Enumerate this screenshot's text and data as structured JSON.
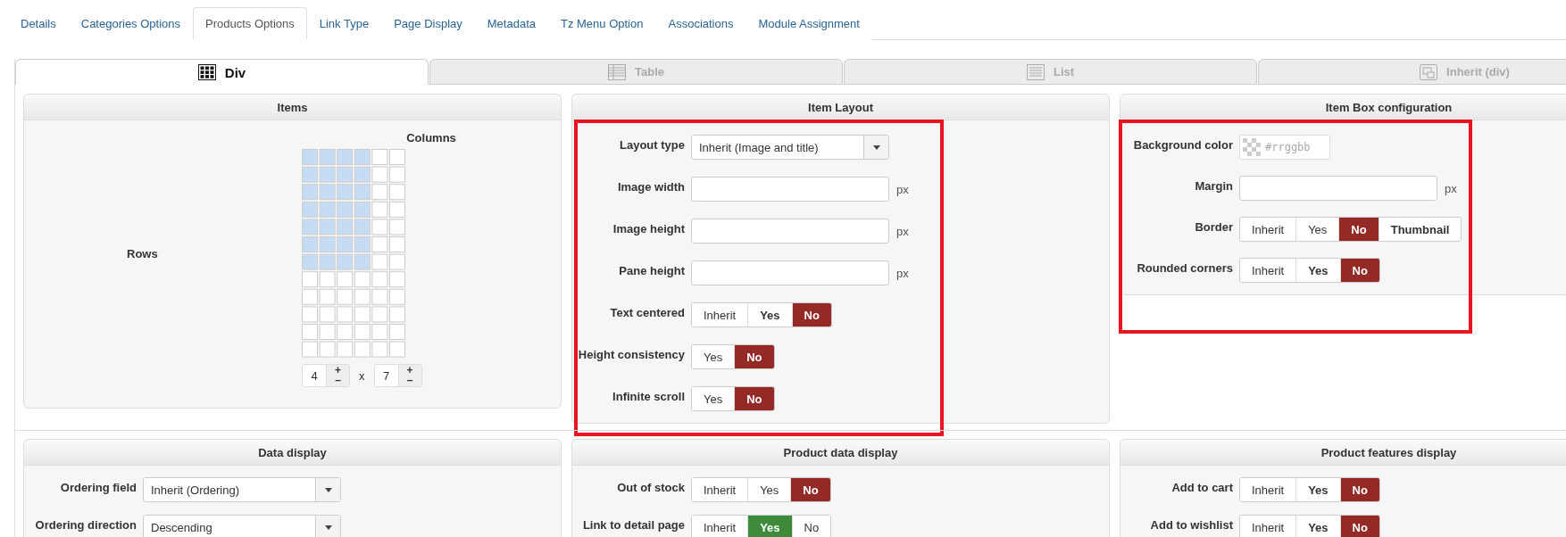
{
  "tabs": [
    {
      "label": "Details",
      "selected": false
    },
    {
      "label": "Categories Options",
      "selected": false
    },
    {
      "label": "Products Options",
      "selected": true
    },
    {
      "label": "Link Type",
      "selected": false
    },
    {
      "label": "Page Display",
      "selected": false
    },
    {
      "label": "Metadata",
      "selected": false
    },
    {
      "label": "Tz Menu Option",
      "selected": false
    },
    {
      "label": "Associations",
      "selected": false
    },
    {
      "label": "Module Assignment",
      "selected": false
    }
  ],
  "view_tabs": [
    {
      "label": "Div",
      "kind": "grid",
      "selected": true
    },
    {
      "label": "Table",
      "kind": "table",
      "selected": false
    },
    {
      "label": "List",
      "kind": "list",
      "selected": false
    },
    {
      "label": "Inherit (div)",
      "kind": "window",
      "selected": false
    }
  ],
  "items_panel": {
    "title": "Items",
    "columns_label": "Columns",
    "rows_label": "Rows",
    "columns": {
      "value": "4",
      "plus": "+",
      "minus": "–"
    },
    "times": "x",
    "rows": {
      "value": "7",
      "plus": "+",
      "minus": "–"
    }
  },
  "top_panels": [
    {
      "title": "Item Layout",
      "highlighted": true,
      "fields": [
        {
          "kind": "select",
          "label": "Layout type",
          "value": "Inherit (Image and title)"
        },
        {
          "kind": "input",
          "label": "Image width",
          "unit": "px"
        },
        {
          "kind": "input",
          "label": "Image height",
          "unit": "px"
        },
        {
          "kind": "input",
          "label": "Pane height",
          "unit": "px"
        },
        {
          "kind": "toggle",
          "label": "Text centered",
          "options": [
            {
              "label": "Inherit",
              "selected": false,
              "emphasized": false
            },
            {
              "label": "Yes",
              "selected": false,
              "emphasized": true
            },
            {
              "label": "No",
              "selected": true,
              "emphasized": false,
              "color": "#942a25"
            }
          ]
        },
        {
          "kind": "toggle",
          "label": "Height consistency",
          "options": [
            {
              "label": "Yes",
              "selected": false,
              "emphasized": false
            },
            {
              "label": "No",
              "selected": true,
              "emphasized": false,
              "color": "#942a25"
            }
          ]
        },
        {
          "kind": "toggle",
          "label": "Infinite scroll",
          "options": [
            {
              "label": "Yes",
              "selected": false,
              "emphasized": false
            },
            {
              "label": "No",
              "selected": true,
              "emphasized": false,
              "color": "#942a25"
            }
          ]
        }
      ]
    },
    {
      "title": "Item Box configuration",
      "highlighted": true,
      "fields": [
        {
          "kind": "color",
          "label": "Background color",
          "placeholder": "#rrggbb"
        },
        {
          "kind": "input",
          "label": "Margin",
          "unit": "px"
        },
        {
          "kind": "toggle",
          "label": "Border",
          "options": [
            {
              "label": "Inherit",
              "selected": false,
              "emphasized": false
            },
            {
              "label": "Yes",
              "selected": false,
              "emphasized": false
            },
            {
              "label": "No",
              "selected": true,
              "emphasized": false,
              "color": "#942a25"
            },
            {
              "label": "Thumbnail",
              "selected": false,
              "emphasized": true
            }
          ]
        },
        {
          "kind": "toggle",
          "label": "Rounded corners",
          "options": [
            {
              "label": "Inherit",
              "selected": false,
              "emphasized": false
            },
            {
              "label": "Yes",
              "selected": false,
              "emphasized": true
            },
            {
              "label": "No",
              "selected": true,
              "emphasized": false,
              "color": "#942a25"
            }
          ]
        }
      ]
    }
  ],
  "bottom_panels": [
    {
      "title": "Data display",
      "fields": [
        {
          "kind": "select",
          "label": "Ordering field",
          "value": "Inherit (Ordering)"
        },
        {
          "kind": "select",
          "label": "Ordering direction",
          "value": "Descending"
        }
      ]
    },
    {
      "title": "Product data display",
      "fields": [
        {
          "kind": "toggle",
          "label": "Out of stock",
          "options": [
            {
              "label": "Inherit",
              "selected": false,
              "emphasized": false
            },
            {
              "label": "Yes",
              "selected": false,
              "emphasized": false
            },
            {
              "label": "No",
              "selected": true,
              "emphasized": false,
              "color": "#942a25"
            }
          ]
        },
        {
          "kind": "toggle",
          "label": "Link to detail page",
          "options": [
            {
              "label": "Inherit",
              "selected": false,
              "emphasized": false
            },
            {
              "label": "Yes",
              "selected": true,
              "emphasized": false,
              "color": "#3c8a3a"
            },
            {
              "label": "No",
              "selected": false,
              "emphasized": false
            }
          ]
        }
      ]
    },
    {
      "title": "Product features display",
      "fields": [
        {
          "kind": "toggle",
          "label": "Add to cart",
          "options": [
            {
              "label": "Inherit",
              "selected": false,
              "emphasized": false
            },
            {
              "label": "Yes",
              "selected": false,
              "emphasized": true
            },
            {
              "label": "No",
              "selected": true,
              "emphasized": false,
              "color": "#942a25"
            }
          ]
        },
        {
          "kind": "toggle",
          "label": "Add to wishlist",
          "options": [
            {
              "label": "Inherit",
              "selected": false,
              "emphasized": false
            },
            {
              "label": "Yes",
              "selected": false,
              "emphasized": true
            },
            {
              "label": "No",
              "selected": true,
              "emphasized": false,
              "color": "#942a25"
            }
          ]
        }
      ]
    }
  ]
}
